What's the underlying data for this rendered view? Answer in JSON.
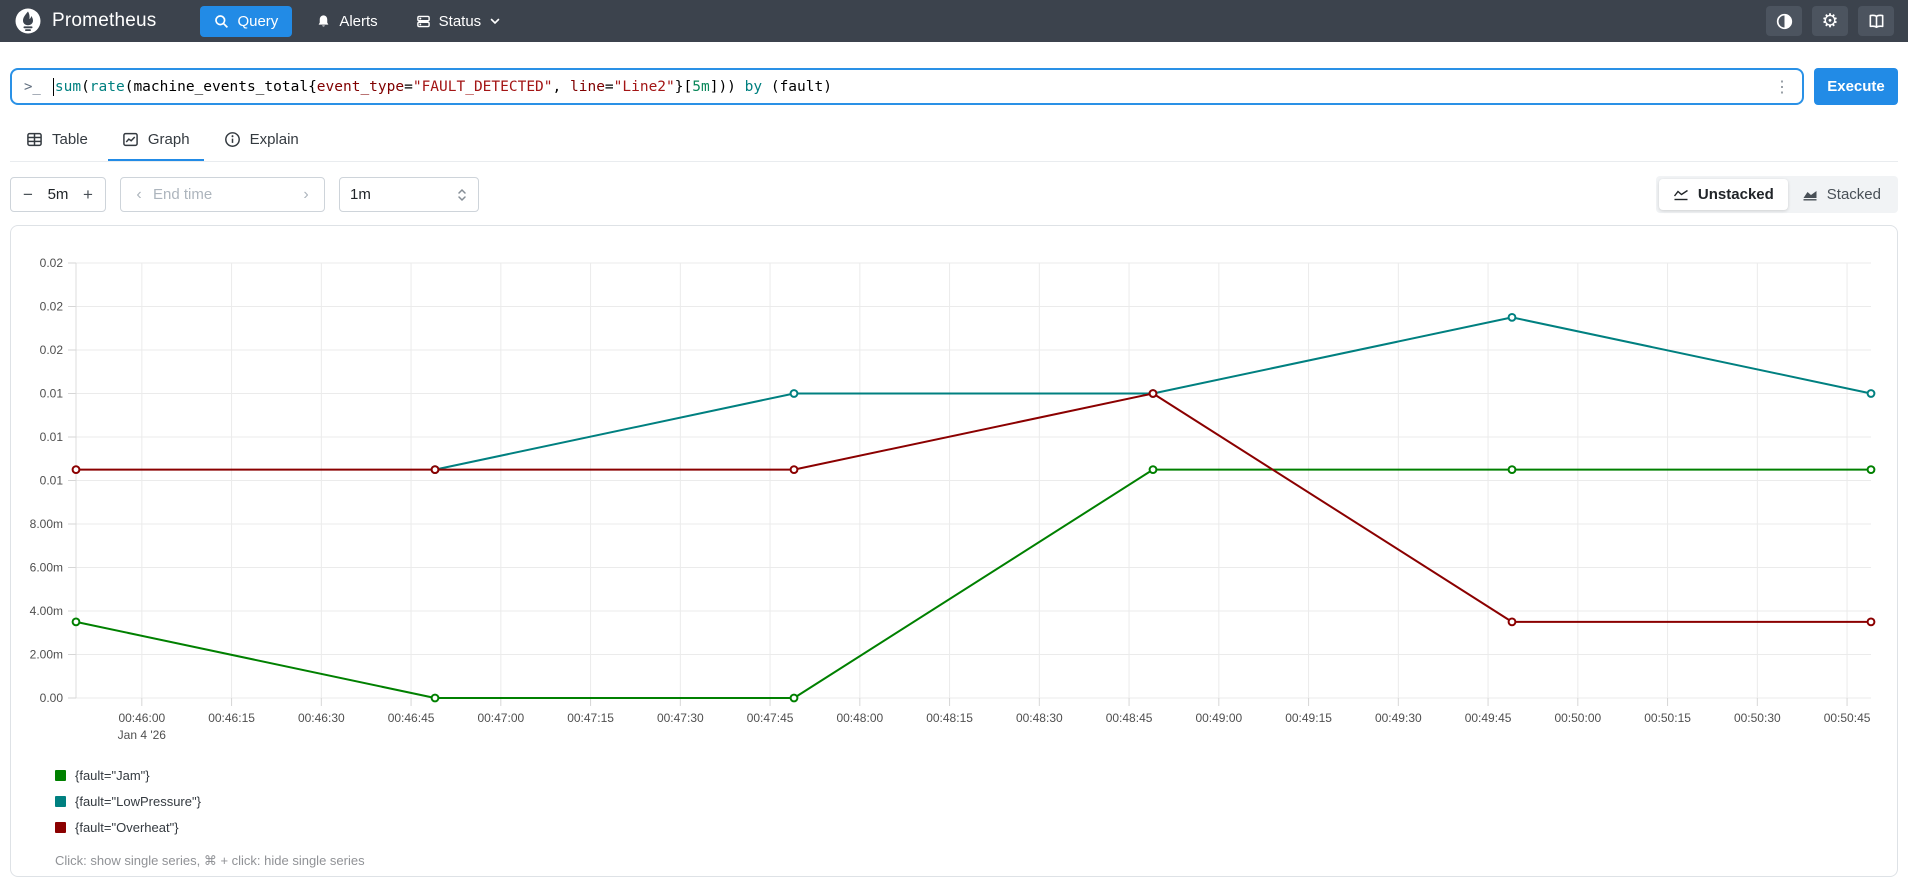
{
  "navbar": {
    "brand": "Prometheus",
    "items": [
      {
        "label": "Query",
        "icon": "search-icon",
        "active": true
      },
      {
        "label": "Alerts",
        "icon": "bell-icon",
        "active": false
      },
      {
        "label": "Status",
        "icon": "server-icon",
        "active": false,
        "has_chevron": true
      }
    ],
    "actions": [
      "theme-toggle",
      "settings",
      "documentation"
    ]
  },
  "query_bar": {
    "prompt": ">_",
    "kebab": "⋮",
    "execute_label": "Execute",
    "query_plain": "sum(rate(machine_events_total{event_type=\"FAULT_DETECTED\", line=\"Line2\"}[5m])) by (fault)",
    "tokens": [
      {
        "t": "sum",
        "c": "fn"
      },
      {
        "t": "(",
        "c": "p"
      },
      {
        "t": "rate",
        "c": "fn"
      },
      {
        "t": "(",
        "c": "p"
      },
      {
        "t": "machine_events_total",
        "c": "p"
      },
      {
        "t": "{",
        "c": "p"
      },
      {
        "t": "event_type",
        "c": "label"
      },
      {
        "t": "=",
        "c": "p"
      },
      {
        "t": "\"FAULT_DETECTED\"",
        "c": "str"
      },
      {
        "t": ", ",
        "c": "p"
      },
      {
        "t": "line",
        "c": "label"
      },
      {
        "t": "=",
        "c": "p"
      },
      {
        "t": "\"Line2\"",
        "c": "str"
      },
      {
        "t": "}",
        "c": "p"
      },
      {
        "t": "[",
        "c": "p"
      },
      {
        "t": "5m",
        "c": "dur"
      },
      {
        "t": "]",
        "c": "p"
      },
      {
        "t": ")) ",
        "c": "p"
      },
      {
        "t": "by",
        "c": "kw"
      },
      {
        "t": " (fault)",
        "c": "p"
      }
    ]
  },
  "tabs": [
    {
      "label": "Table",
      "icon": "table-icon",
      "active": false
    },
    {
      "label": "Graph",
      "icon": "graph-icon",
      "active": true
    },
    {
      "label": "Explain",
      "icon": "info-icon",
      "active": false
    }
  ],
  "controls": {
    "range": {
      "decrease": "−",
      "value": "5m",
      "increase": "+"
    },
    "end_time": {
      "prev": "‹",
      "placeholder": "End time",
      "next": "›"
    },
    "resolution": {
      "value": "1m"
    },
    "stacking": [
      {
        "label": "Unstacked",
        "icon": "line-chart-icon",
        "active": true
      },
      {
        "label": "Stacked",
        "icon": "area-chart-icon",
        "active": false
      }
    ]
  },
  "chart_data": {
    "type": "line",
    "title": "",
    "xlabel": "",
    "ylabel": "",
    "ylim": [
      0,
      0.02
    ],
    "x_range_seconds": [
      0,
      300
    ],
    "x_start_time": "00:45:49",
    "x_step_seconds": 60,
    "grid": true,
    "legend_position": "bottom",
    "x_seconds": [
      0,
      60,
      120,
      180,
      240,
      300
    ],
    "series": [
      {
        "name": "{fault=\"Jam\"}",
        "color": "#008000",
        "values": [
          0.0035,
          0,
          0,
          0.0105,
          0.0105,
          0.0105
        ]
      },
      {
        "name": "{fault=\"LowPressure\"}",
        "color": "#008080",
        "values": [
          null,
          0.0105,
          0.014,
          0.014,
          0.0175,
          0.014
        ]
      },
      {
        "name": "{fault=\"Overheat\"}",
        "color": "#8b0000",
        "values": [
          0.0105,
          0.0105,
          0.0105,
          0.014,
          0.0035,
          0.0035
        ]
      }
    ],
    "y_ticks": [
      {
        "value": 0.02,
        "label": "0.02"
      },
      {
        "value": 0.018,
        "label": "0.02"
      },
      {
        "value": 0.016,
        "label": "0.02"
      },
      {
        "value": 0.014,
        "label": "0.01"
      },
      {
        "value": 0.012,
        "label": "0.01"
      },
      {
        "value": 0.01,
        "label": "0.01"
      },
      {
        "value": 0.008,
        "label": "8.00m"
      },
      {
        "value": 0.006,
        "label": "6.00m"
      },
      {
        "value": 0.004,
        "label": "4.00m"
      },
      {
        "value": 0.002,
        "label": "2.00m"
      },
      {
        "value": 0.0,
        "label": "0.00"
      }
    ],
    "x_ticks": [
      {
        "offset_seconds": 11,
        "label": "00:46:00",
        "sub": "Jan 4 '26"
      },
      {
        "offset_seconds": 26,
        "label": "00:46:15"
      },
      {
        "offset_seconds": 41,
        "label": "00:46:30"
      },
      {
        "offset_seconds": 56,
        "label": "00:46:45"
      },
      {
        "offset_seconds": 71,
        "label": "00:47:00"
      },
      {
        "offset_seconds": 86,
        "label": "00:47:15"
      },
      {
        "offset_seconds": 101,
        "label": "00:47:30"
      },
      {
        "offset_seconds": 116,
        "label": "00:47:45"
      },
      {
        "offset_seconds": 131,
        "label": "00:48:00"
      },
      {
        "offset_seconds": 146,
        "label": "00:48:15"
      },
      {
        "offset_seconds": 161,
        "label": "00:48:30"
      },
      {
        "offset_seconds": 176,
        "label": "00:48:45"
      },
      {
        "offset_seconds": 191,
        "label": "00:49:00"
      },
      {
        "offset_seconds": 206,
        "label": "00:49:15"
      },
      {
        "offset_seconds": 221,
        "label": "00:49:30"
      },
      {
        "offset_seconds": 236,
        "label": "00:49:45"
      },
      {
        "offset_seconds": 251,
        "label": "00:50:00"
      },
      {
        "offset_seconds": 266,
        "label": "00:50:15"
      },
      {
        "offset_seconds": 281,
        "label": "00:50:30"
      },
      {
        "offset_seconds": 296,
        "label": "00:50:45"
      }
    ]
  },
  "legend": {
    "items": [
      {
        "label": "{fault=\"Jam\"}",
        "color": "#008000"
      },
      {
        "label": "{fault=\"LowPressure\"}",
        "color": "#008080"
      },
      {
        "label": "{fault=\"Overheat\"}",
        "color": "#8b0000"
      }
    ],
    "hint": "Click: show single series, ⌘ + click: hide single series"
  },
  "colors": {
    "accent_blue": "#228be6",
    "navbar_bg": "#3c434d",
    "grid": "#ebebeb",
    "string": "#a31515",
    "keyword": "#008080",
    "label_name": "#800000",
    "duration": "#09885a"
  }
}
